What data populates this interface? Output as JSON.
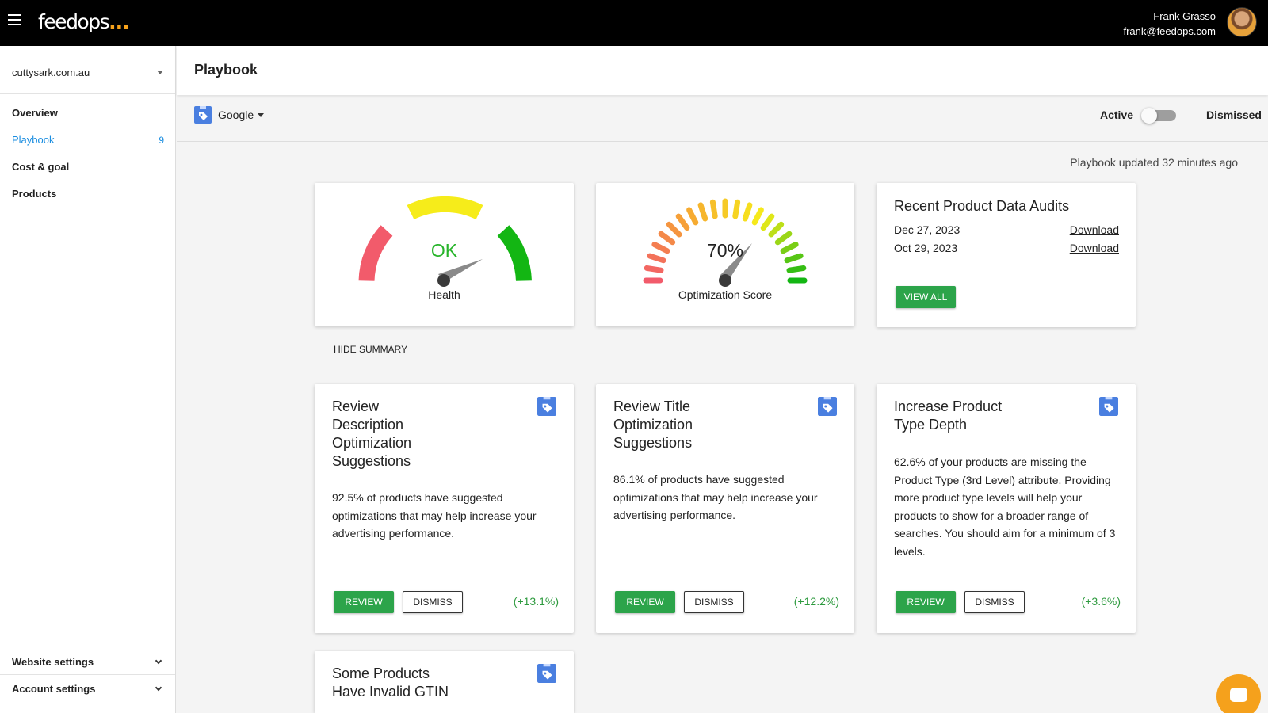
{
  "app": {
    "logo_text": "feedops",
    "logo_dots": "...",
    "user_name": "Frank Grasso",
    "user_email": "frank@feedops.com"
  },
  "sidebar": {
    "site": "cuttysark.com.au",
    "items": [
      {
        "label": "Overview",
        "badge": ""
      },
      {
        "label": "Playbook",
        "badge": "9"
      },
      {
        "label": "Cost & goal",
        "badge": ""
      },
      {
        "label": "Products",
        "badge": ""
      }
    ],
    "website_settings": "Website settings",
    "account_settings": "Account settings"
  },
  "header": {
    "title": "Playbook"
  },
  "filter": {
    "channel": "Google",
    "toggle_left": "Active",
    "toggle_right": "Dismissed",
    "toggle_on": false
  },
  "updated_text": "Playbook updated 32 minutes ago",
  "summary": {
    "health": {
      "value": "OK",
      "caption": "Health"
    },
    "optimization": {
      "value": "70%",
      "score": 70,
      "caption": "Optimization Score"
    },
    "audits": {
      "title": "Recent Product Data Audits",
      "rows": [
        {
          "date": "Dec 27, 2023",
          "link": "Download"
        },
        {
          "date": "Oct 29, 2023",
          "link": "Download"
        }
      ],
      "view_all": "VIEW ALL"
    },
    "hide_label": "HIDE SUMMARY"
  },
  "recommendations": [
    {
      "title": "Review Description Optimization Suggestions",
      "text": "92.5% of products have suggested optimizations that may help increase your advertising performance.",
      "review": "REVIEW",
      "dismiss": "DISMISS",
      "impact": "(+13.1%)"
    },
    {
      "title": "Review Title Optimization Suggestions",
      "text": "86.1% of products have suggested optimizations that may help increase your advertising performance.",
      "review": "REVIEW",
      "dismiss": "DISMISS",
      "impact": "(+12.2%)"
    },
    {
      "title": "Increase Product Type Depth",
      "text": "62.6% of your products are missing the Product Type (3rd Level) attribute. Providing more product type levels will help your products to show for a broader range of searches. You should aim for a minimum of 3 levels.",
      "review": "REVIEW",
      "dismiss": "DISMISS",
      "impact": "(+3.6%)"
    },
    {
      "title": "Some Products Have Invalid GTIN",
      "text": "",
      "review": "",
      "dismiss": "",
      "impact": ""
    }
  ],
  "colors": {
    "accent_blue": "#1a8de0",
    "button_green": "#2ca44a",
    "chat_orange": "#f5a11c",
    "gauge_red": "#f25b6b",
    "gauge_yellow": "#f6ec1a",
    "gauge_green": "#13b613"
  },
  "icons": {
    "menu": "hamburger-icon",
    "channel": "google-shopping-tag-icon",
    "chat": "chat-bubble-icon"
  }
}
